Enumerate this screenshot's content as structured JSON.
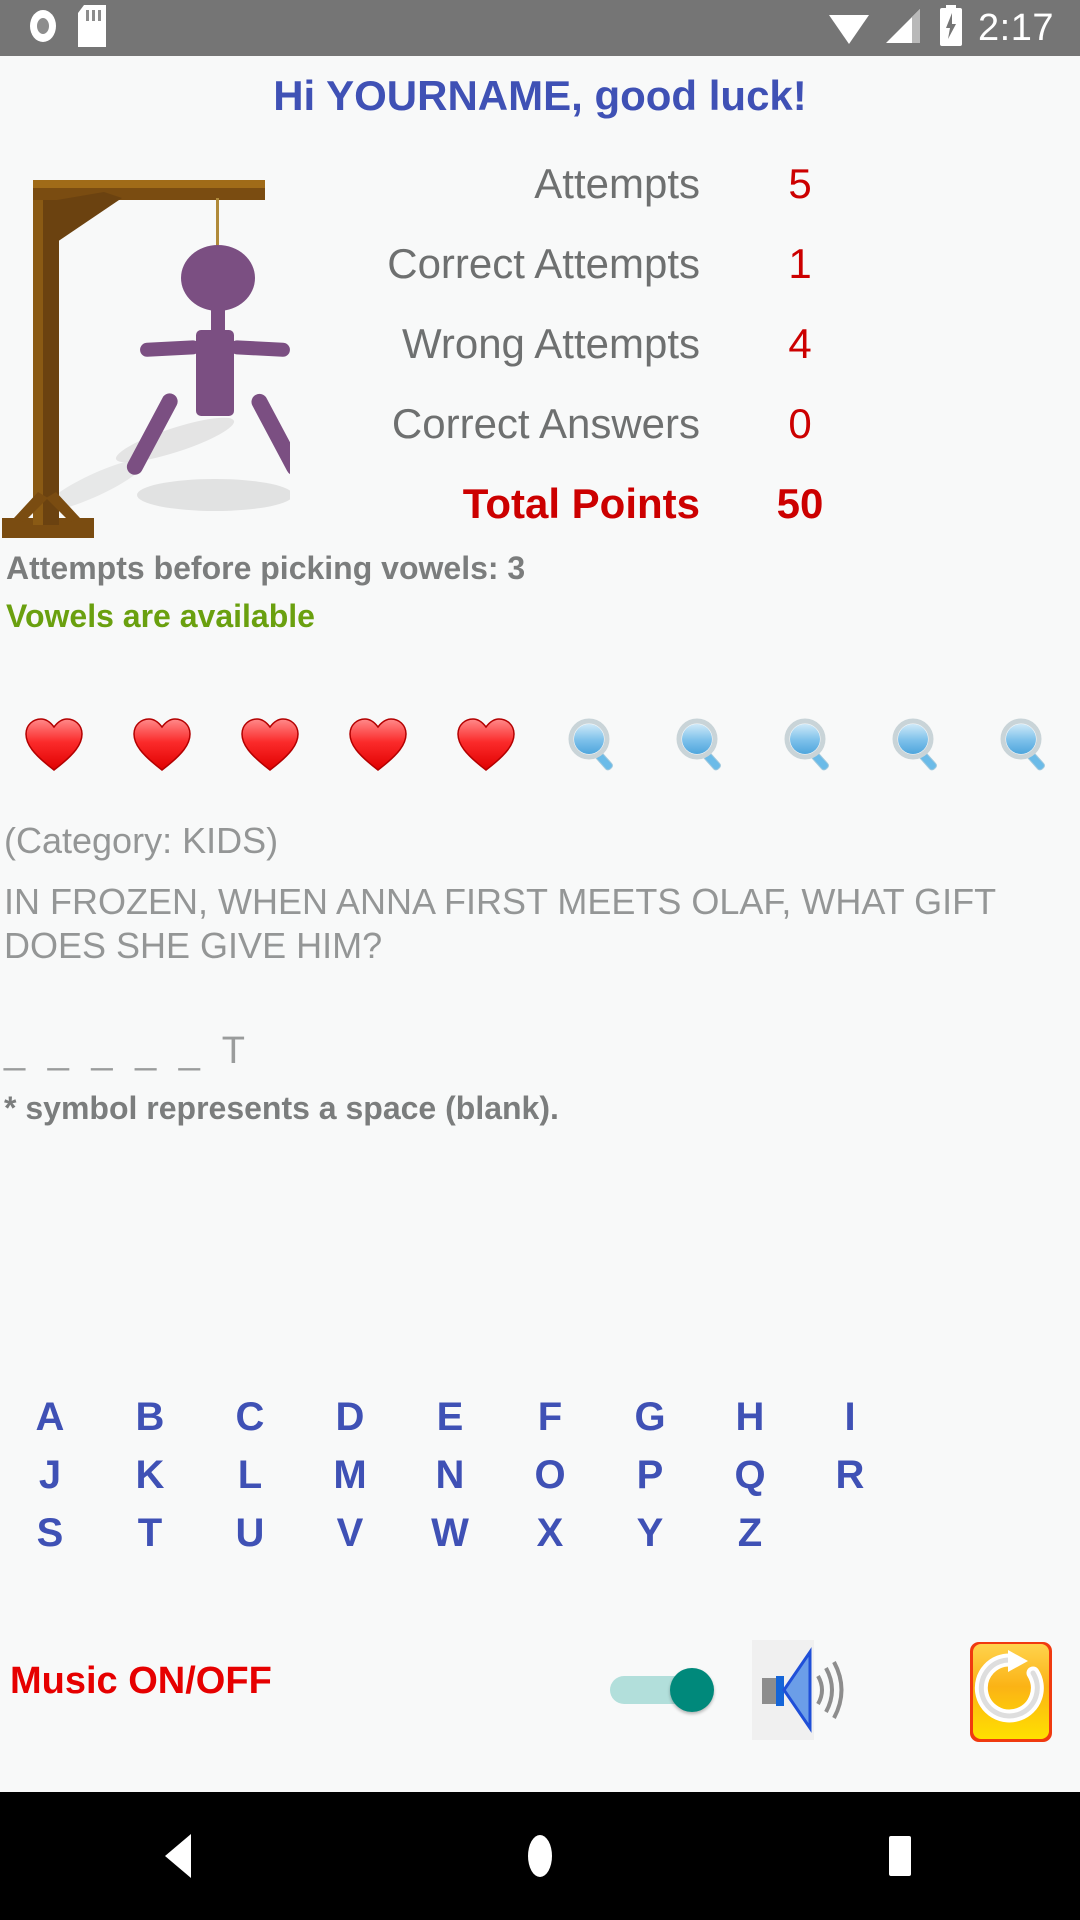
{
  "status_bar": {
    "icons": [
      "record-icon",
      "sd-card-icon",
      "wifi-icon",
      "signal-icon",
      "battery-charging-icon"
    ],
    "clock": "2:17"
  },
  "header": {
    "greeting": "Hi YOURNAME, good luck!",
    "greeting_color": "#3f51b5"
  },
  "hangman": {
    "icon": "hangman-figure",
    "gallows_color": "#8a5a14",
    "figure_color": "#7b4f82"
  },
  "stats": {
    "rows": [
      {
        "label": "Attempts",
        "value": "5"
      },
      {
        "label": "Correct Attempts",
        "value": "1"
      },
      {
        "label": "Wrong Attempts",
        "value": "4"
      },
      {
        "label": "Correct Answers",
        "value": "0"
      },
      {
        "label": "Total Points",
        "value": "50"
      }
    ],
    "label_color": "#6e7070",
    "value_color": "#cc0000",
    "total_color": "#cc0000"
  },
  "vowel_info": {
    "attempts_before_vowels": "Attempts before picking vowels: 3",
    "vowels_status": "Vowels are available",
    "vowels_status_color": "#6aa00f"
  },
  "life_icons": {
    "hearts": 5,
    "magnifiers": 5,
    "heart_icon_name": "heart-icon",
    "magnifier_icon_name": "magnifier-icon"
  },
  "question": {
    "category": "(Category: KIDS)",
    "text": "IN FROZEN, WHEN ANNA FIRST MEETS OLAF, WHAT GIFT DOES SHE GIVE HIM?",
    "blanks": "_ _ _ _ _ T",
    "hint": "* symbol represents a space (blank)."
  },
  "alphabet": {
    "rows": [
      [
        "A",
        "B",
        "C",
        "D",
        "E",
        "F",
        "G",
        "H",
        "I"
      ],
      [
        "J",
        "K",
        "L",
        "M",
        "N",
        "O",
        "P",
        "Q",
        "R"
      ],
      [
        "S",
        "T",
        "U",
        "V",
        "W",
        "X",
        "Y",
        "Z",
        ""
      ]
    ],
    "letter_color": "#3f51b5"
  },
  "controls": {
    "music_label": "Music ON/OFF",
    "music_label_color": "#e60000",
    "music_toggle_on": true,
    "toggle_track_color": "#b2dfdb",
    "toggle_knob_color": "#00897b",
    "speaker_icon": "speaker-volume-icon",
    "refresh_icon": "refresh-button-icon"
  },
  "navbar": {
    "back": "back-triangle-icon",
    "home": "home-circle-icon",
    "recents": "recents-square-icon"
  }
}
